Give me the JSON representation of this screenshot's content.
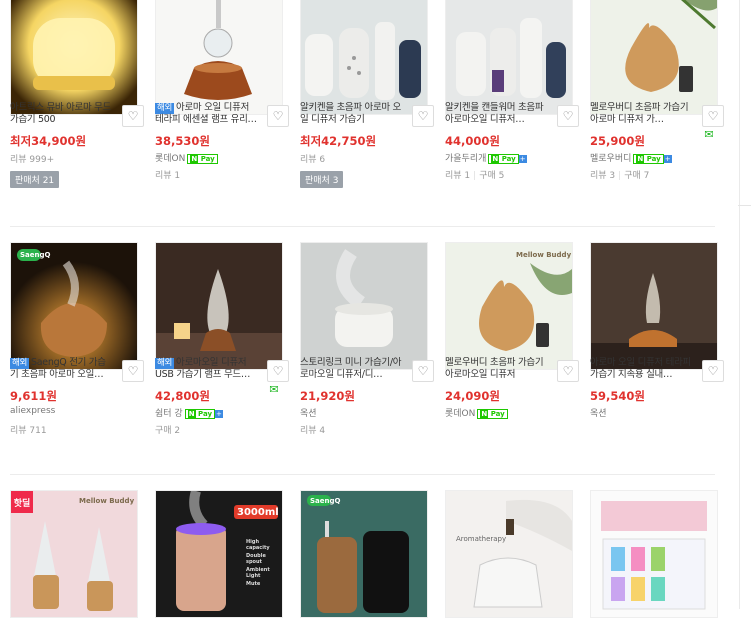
{
  "rows": [
    {
      "items": [
        {
          "title": "아트릭스 뮤바 아로마 무드가습기 500",
          "tag": "",
          "price": "최저34,900원",
          "mall": "",
          "npay": false,
          "meta": [
            "리뷰 999+"
          ],
          "seller": "판매처 21",
          "talk": false
        },
        {
          "title": "아로마 오일 디퓨저 테라피 에센셜 램프 유리…",
          "tag": "해외",
          "price": "38,530원",
          "mall": "롯데ON",
          "npay": true,
          "meta": [
            "리뷰 1"
          ],
          "seller": "",
          "talk": false
        },
        {
          "title": "알키켄을 초음파 아로마 오일 디퓨저 가습기",
          "tag": "",
          "price": "최저42,750원",
          "mall": "",
          "npay": false,
          "meta": [
            "리뷰 6"
          ],
          "seller": "판매처 3",
          "talk": false
        },
        {
          "title": "알키켄을 캔들워머 초음파 아로마오일 디퓨저…",
          "tag": "",
          "price": "44,000원",
          "mall": "가을두리개",
          "npay": true,
          "meta": [
            "리뷰 1",
            "구매 5"
          ],
          "seller": "",
          "talk": false
        },
        {
          "title": "멜로우버디 초음파 가습기 아로마 디퓨저 가…",
          "tag": "",
          "price": "25,900원",
          "mall": "멜로우버디",
          "npay": true,
          "meta": [
            "리뷰 3",
            "구매 7"
          ],
          "seller": "",
          "talk": true
        }
      ]
    },
    {
      "items": [
        {
          "title": "SaengQ 전기 가습기 초음파 아로마 오일…",
          "tag": "해외",
          "price": "9,611원",
          "mall": "aliexpress",
          "npay": false,
          "meta": [
            "리뷰 711"
          ],
          "seller": "",
          "talk": false
        },
        {
          "title": "아로마오일 디퓨저 USB 가습기 램프 무드…",
          "tag": "해외",
          "price": "42,800원",
          "mall": "쉼터 강",
          "npay": true,
          "meta": [
            "구매 2"
          ],
          "seller": "",
          "talk": true
        },
        {
          "title": "스토리링크 미니 가습기/아로마오일 디퓨저/디…",
          "tag": "",
          "price": "21,920원",
          "mall": "옥션",
          "npay": false,
          "meta": [
            "리뷰 4"
          ],
          "seller": "",
          "talk": false
        },
        {
          "title": "멜로우버디 초음파 가습기 아로마오일 디퓨저",
          "tag": "",
          "price": "24,090원",
          "mall": "롯데ON",
          "npay": true,
          "meta": [],
          "seller": "",
          "talk": false
        },
        {
          "title": "아로마 오일 디퓨저 테라피 가습기 지속용 실내…",
          "tag": "",
          "price": "59,540원",
          "mall": "옥션",
          "npay": false,
          "meta": [],
          "seller": "",
          "talk": false
        }
      ]
    }
  ],
  "bottom_row": {
    "hotdeal": "핫딜",
    "brand_mellow": "Mellow Buddy",
    "brand_saengq": "SaengQ",
    "capacity": "3000ml",
    "specs": [
      "High capacity",
      "Double spout",
      "Ambient Light",
      "Mute"
    ],
    "aromatherapy": "Aromatherapy"
  },
  "labels": {
    "heart_icon": "♡",
    "talk_icon": "✉",
    "npay_n": "N",
    "npay_text": "Pay",
    "npay_plus": "+"
  }
}
